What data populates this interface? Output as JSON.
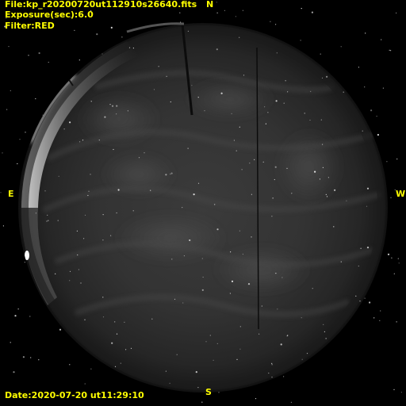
{
  "header": {
    "file": "File:kp_r20200720ut112910s26640.fits",
    "exposure": "Exposure(sec):6.0",
    "filter": "Filter:RED"
  },
  "footer": {
    "date": "Date:2020-07-20  ut11:29:10"
  },
  "directions": {
    "north": "N",
    "south": "S",
    "east": "E",
    "west": "W"
  },
  "colors": {
    "label": "#ffff00",
    "background": "#000000"
  }
}
